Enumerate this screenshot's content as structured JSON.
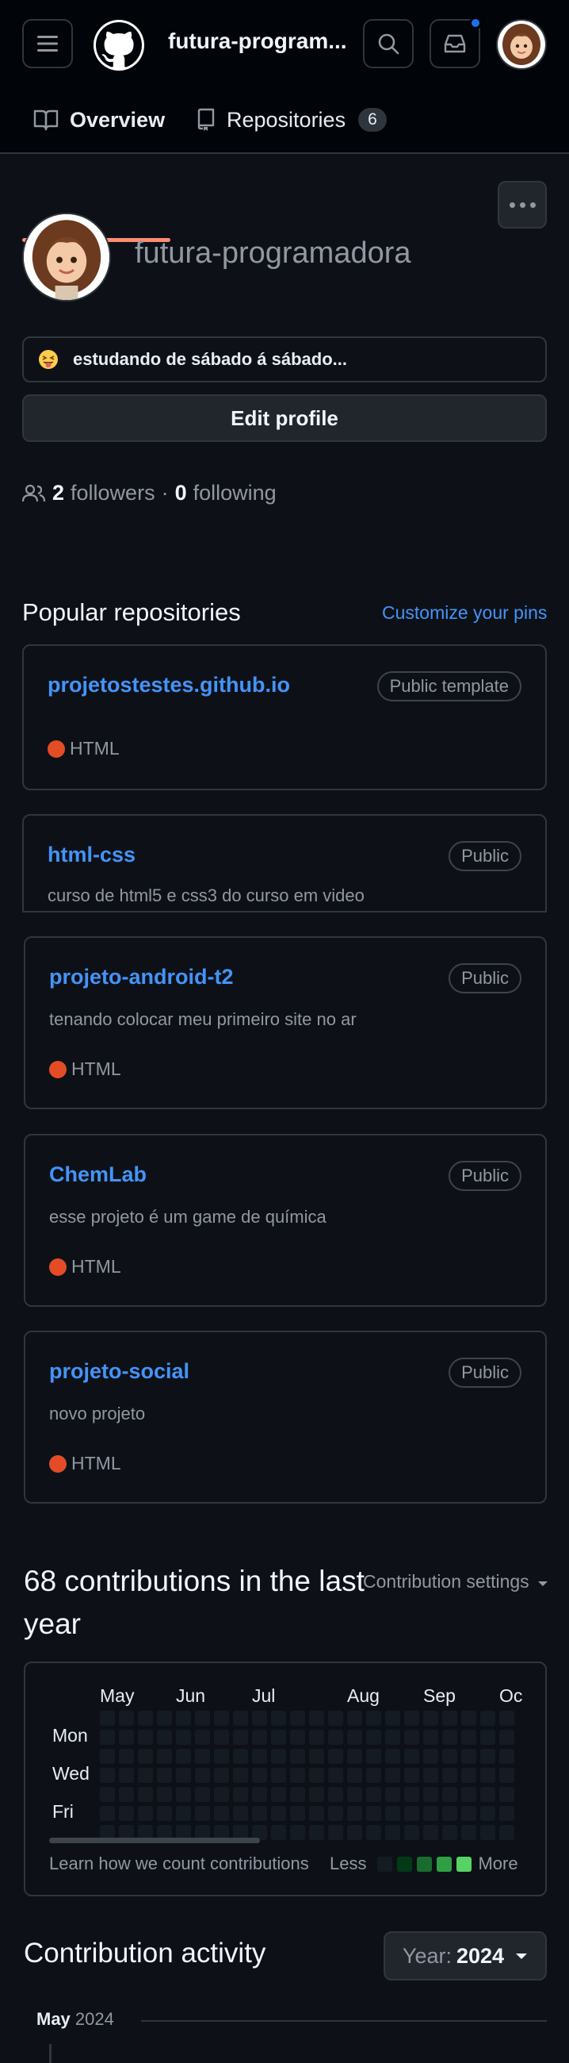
{
  "header": {
    "username": "futura-program...",
    "menu_icon": "hamburger-icon",
    "search_icon": "search-icon",
    "inbox_icon": "inbox-icon"
  },
  "nav": {
    "tabs": [
      {
        "label": "Overview",
        "icon": "book-icon",
        "active": true
      },
      {
        "label": "Repositories",
        "icon": "repo-icon",
        "count": "6"
      }
    ]
  },
  "profile": {
    "username": "futura-programadora",
    "status_emoji": "stuck-out-tongue-face",
    "status_text": "estudando de sábado á sábado...",
    "edit_label": "Edit profile",
    "followers_count": "2",
    "followers_label": "followers",
    "separator": "·",
    "following_count": "0",
    "following_label": "following"
  },
  "popular": {
    "title": "Popular repositories",
    "customize_label": "Customize your pins",
    "repos": [
      {
        "name": "projetostestes.github.io",
        "badge": "Public template",
        "description": "",
        "language": "HTML"
      },
      {
        "name": "html-css",
        "badge": "Public",
        "description": "curso de html5 e css3 do curso em video",
        "language": ""
      },
      {
        "name": "projeto-android-t2",
        "badge": "Public",
        "description": "tenando colocar meu primeiro site no ar",
        "language": "HTML"
      },
      {
        "name": "ChemLab",
        "badge": "Public",
        "description": "esse projeto é um game de química",
        "language": "HTML"
      },
      {
        "name": "projeto-social",
        "badge": "Public",
        "description": "novo projeto",
        "language": "HTML"
      }
    ]
  },
  "contributions": {
    "title": "68 contributions in the last year",
    "settings_label": "Contribution settings",
    "months": [
      "May",
      "Jun",
      "Jul",
      "Aug",
      "Sep",
      "Oc"
    ],
    "days": [
      "Mon",
      "Wed",
      "Fri"
    ],
    "learn_label": "Learn how we count contributions",
    "less_label": "Less",
    "more_label": "More",
    "legend_colors": [
      "#151b23",
      "#033a16",
      "#196c2e",
      "#2ea043",
      "#56d364"
    ]
  },
  "activity": {
    "title": "Contribution activity",
    "year_prefix": "Year:",
    "year_value": "2024",
    "month_label": "May",
    "month_year": "2024"
  }
}
